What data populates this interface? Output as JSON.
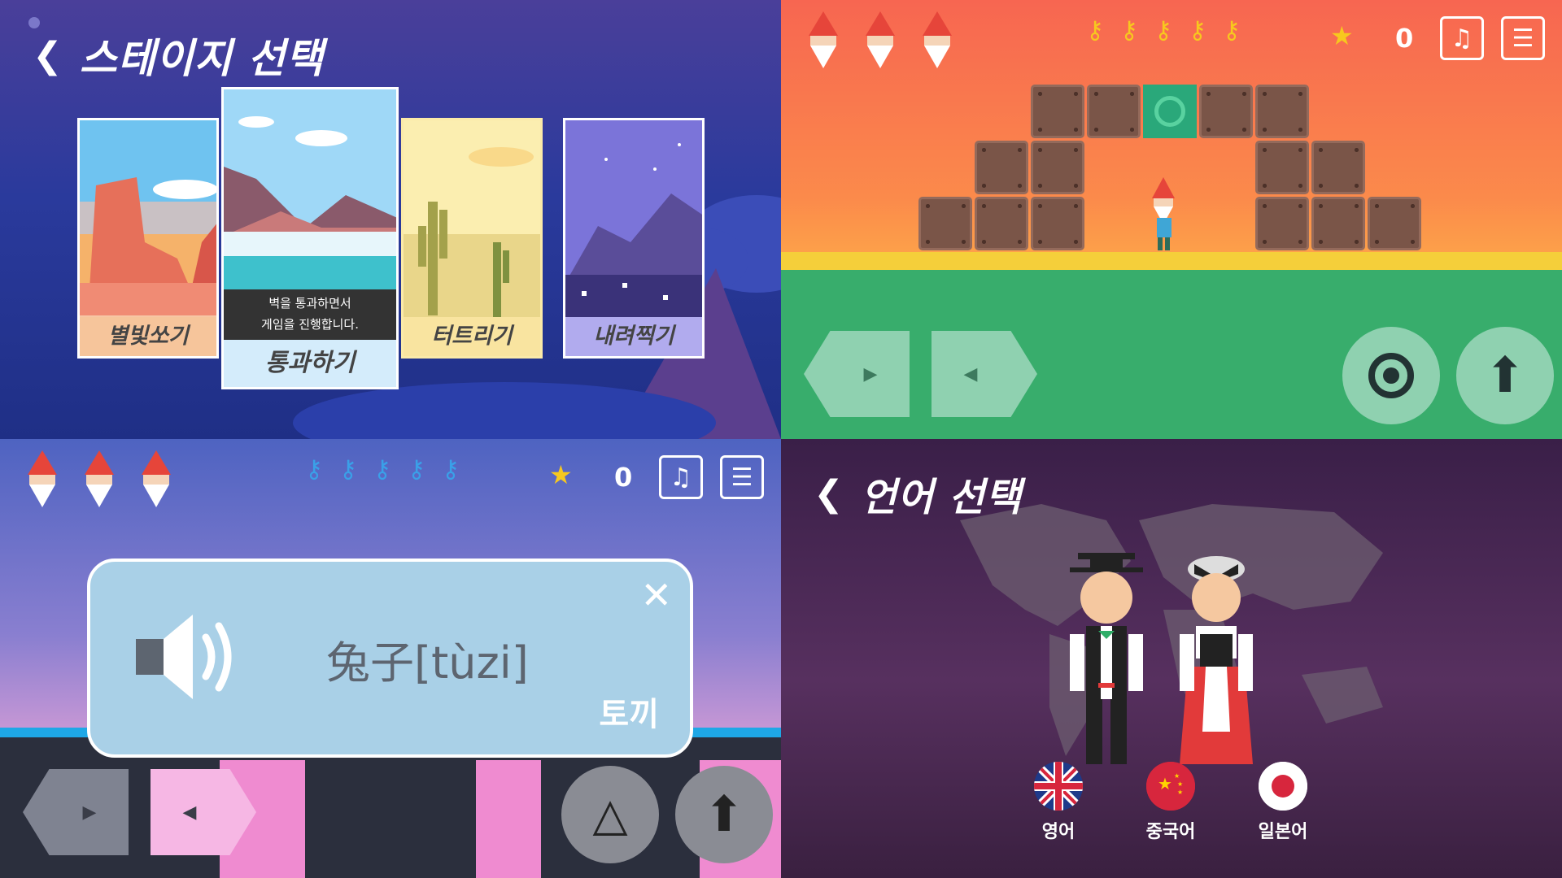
{
  "stage_select": {
    "back_icon": "chevron-left-icon",
    "title": "스테이지 선택",
    "tooltip_line1": "벽을 통과하면서",
    "tooltip_line2": "게임을 진행합니다.",
    "stages": [
      {
        "label": "별빛쏘기"
      },
      {
        "label": "통과하기"
      },
      {
        "label": "터트리기"
      },
      {
        "label": "내려찍기"
      }
    ]
  },
  "game_red": {
    "score": "0",
    "star_icon": "star-icon",
    "key_icon": "key-icon",
    "music_icon": "music-note-icon",
    "menu_icon": "menu-icon",
    "accent_bg": "#f76651"
  },
  "game_blue": {
    "score": "0",
    "word_popup": {
      "word": "兔子[tùzi]",
      "meaning": "토끼",
      "close_icon": "close-icon",
      "speaker_icon": "speaker-icon"
    }
  },
  "language_select": {
    "back_icon": "chevron-left-icon",
    "title": "언어 선택",
    "languages": [
      {
        "label": "영어",
        "flag": "uk-flag"
      },
      {
        "label": "중국어",
        "flag": "china-flag"
      },
      {
        "label": "일본어",
        "flag": "japan-flag"
      }
    ]
  }
}
